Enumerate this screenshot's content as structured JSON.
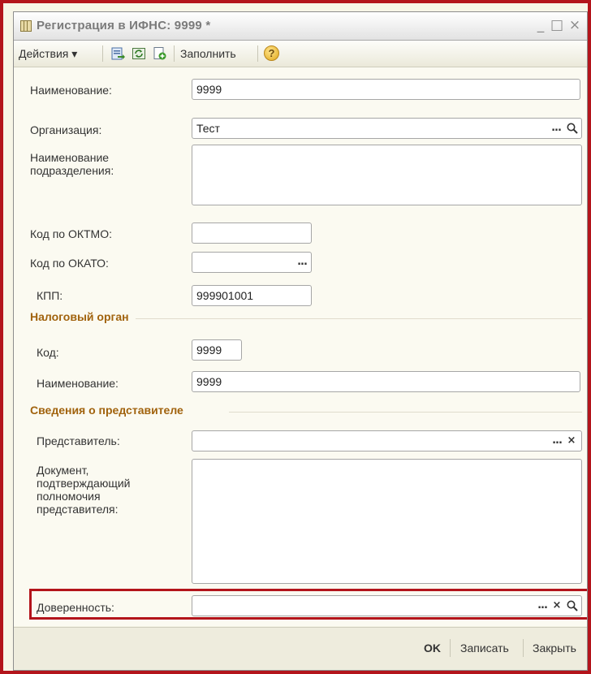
{
  "window": {
    "title": "Регистрация в ИФНС: 9999 *",
    "minimize": "_",
    "maximize": "□",
    "close": "×"
  },
  "toolbar": {
    "actions_label": "Действия ▾",
    "fill_label": "Заполнить",
    "help_label": "?"
  },
  "form": {
    "name_label": "Наименование:",
    "name_value": "9999",
    "org_label": "Организация:",
    "org_value": "Тест",
    "subdivision_label_1": "Наименование",
    "subdivision_label_2": "подразделения:",
    "subdivision_value": "",
    "oktmo_label": "Код по ОКТМО:",
    "oktmo_value": "",
    "okato_label": "Код по ОКАТО:",
    "okato_value": "",
    "kpp_label": "КПП:",
    "kpp_value": "999901001"
  },
  "tax_authority": {
    "section_title": "Налоговый орган",
    "code_label": "Код:",
    "code_value": "9999",
    "name_label": "Наименование:",
    "name_value": "9999"
  },
  "representative": {
    "section_title": "Сведения о представителе",
    "rep_label": "Представитель:",
    "rep_value": "",
    "doc_label_1": "Документ,",
    "doc_label_2": "подтверждающий",
    "doc_label_3": "полномочия",
    "doc_label_4": "представителя:",
    "doc_value": "",
    "poa_label": "Доверенность:",
    "poa_value": ""
  },
  "field_buttons": {
    "select": "...",
    "clear": "×",
    "open": "🔍"
  },
  "footer": {
    "ok": "OK",
    "save": "Записать",
    "close": "Закрыть"
  }
}
